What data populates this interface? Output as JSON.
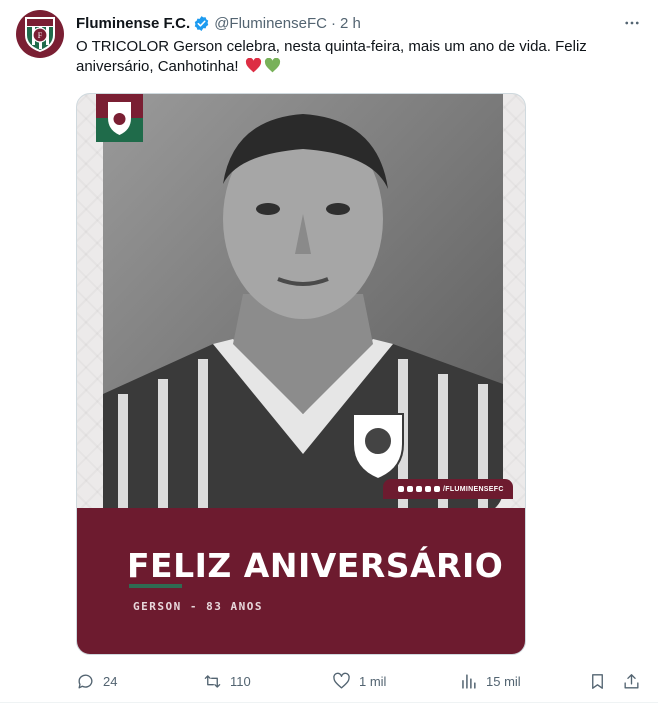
{
  "tweet": {
    "display_name": "Fluminense F.C.",
    "handle": "@FluminenseFC",
    "separator": "·",
    "time": "2 h",
    "text": "O TRICOLOR Gerson celebra, nesta quinta-feira, mais um ano de vida. Feliz aniversário, Canhotinha!",
    "emoji": [
      "red-heart",
      "green-heart"
    ]
  },
  "media": {
    "title": "FELIZ ANIVERSÁRIO",
    "subtitle": "GERSON - 83 ANOS",
    "social_tag": "/FLUMINENSEFC"
  },
  "actions": {
    "replies": "24",
    "retweets": "110",
    "likes": "1 mil",
    "views": "15 mil"
  },
  "colors": {
    "brand_maroon": "#6d1b2f",
    "brand_green": "#2f6b52",
    "verified_blue": "#1d9bf0",
    "muted_text": "#536471"
  }
}
